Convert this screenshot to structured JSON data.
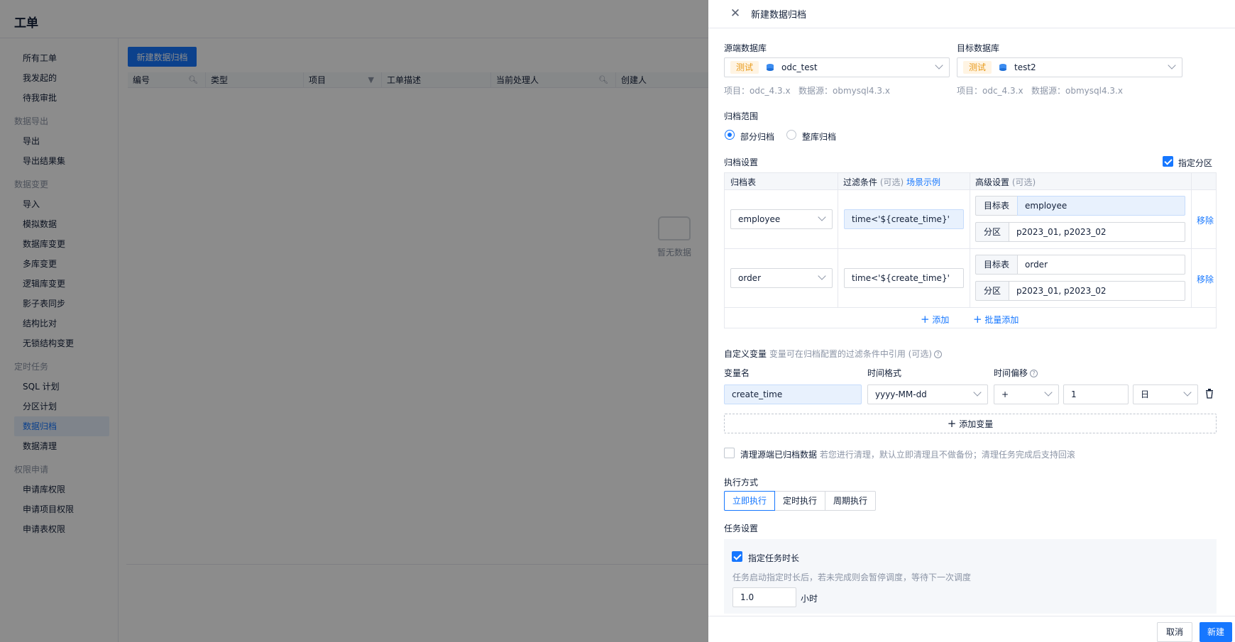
{
  "app": {
    "title": "工单",
    "sidebar": [
      {
        "type": "item",
        "label": "所有工单"
      },
      {
        "type": "item",
        "label": "我发起的"
      },
      {
        "type": "item",
        "label": "待我审批"
      },
      {
        "type": "group",
        "label": "数据导出"
      },
      {
        "type": "item",
        "label": "导出"
      },
      {
        "type": "item",
        "label": "导出结果集"
      },
      {
        "type": "group",
        "label": "数据变更"
      },
      {
        "type": "item",
        "label": "导入"
      },
      {
        "type": "item",
        "label": "模拟数据"
      },
      {
        "type": "item",
        "label": "数据库变更"
      },
      {
        "type": "item",
        "label": "多库变更"
      },
      {
        "type": "item",
        "label": "逻辑库变更"
      },
      {
        "type": "item",
        "label": "影子表同步"
      },
      {
        "type": "item",
        "label": "结构比对"
      },
      {
        "type": "item",
        "label": "无锁结构变更"
      },
      {
        "type": "group",
        "label": "定时任务"
      },
      {
        "type": "item",
        "label": "SQL 计划"
      },
      {
        "type": "item",
        "label": "分区计划"
      },
      {
        "type": "item",
        "label": "数据归档",
        "active": true
      },
      {
        "type": "item",
        "label": "数据清理"
      },
      {
        "type": "group",
        "label": "权限申请"
      },
      {
        "type": "item",
        "label": "申请库权限"
      },
      {
        "type": "item",
        "label": "申请项目权限"
      },
      {
        "type": "item",
        "label": "申请表权限"
      }
    ],
    "new_button": "新建数据归档",
    "columns": [
      "编号",
      "类型",
      "项目",
      "工单描述",
      "当前处理人",
      "创建人"
    ],
    "empty_text": "暂无数据"
  },
  "drawer": {
    "title": "新建数据归档",
    "source": {
      "label": "源端数据库",
      "env": "测试",
      "db": "odc_test",
      "project_meta": "项目：odc_4.3.x",
      "datasource_meta": "数据源：obmysql4.3.x"
    },
    "target": {
      "label": "目标数据库",
      "env": "测试",
      "db": "test2",
      "project_meta": "项目：odc_4.3.x",
      "datasource_meta": "数据源：obmysql4.3.x"
    },
    "scope": {
      "label": "归档范围",
      "options": [
        "部分归档",
        "整库归档"
      ],
      "selected": "部分归档"
    },
    "settings": {
      "label": "归档设置",
      "partition_check_label": "指定分区",
      "col_table": "归档表",
      "col_filter": "过滤条件",
      "col_filter_opt": "(可选)",
      "col_filter_link": "场景示例",
      "col_advanced": "高级设置",
      "col_advanced_opt": "(可选)",
      "target_table_prefix": "目标表",
      "partition_prefix": "分区",
      "remove_label": "移除",
      "rows": [
        {
          "table": "employee",
          "filter": "time<'${create_time}'",
          "target": "employee",
          "partitions": "p2023_01, p2023_02"
        },
        {
          "table": "order",
          "filter": "time<'${create_time}'",
          "target": "order",
          "partitions": "p2023_01, p2023_02"
        }
      ],
      "add_label": "添加",
      "batch_add_label": "批量添加"
    },
    "variables": {
      "label": "自定义变量",
      "hint": "变量可在归档配置的过滤条件中引用 (可选)",
      "col_name": "变量名",
      "col_format": "时间格式",
      "col_offset": "时间偏移",
      "name_value": "create_time",
      "format_value": "yyyy-MM-dd",
      "offset_sign": "+",
      "offset_value": "1",
      "offset_unit": "日",
      "add_label": "添加变量"
    },
    "cleanup": {
      "label": "清理源端已归档数据",
      "hint": "若您进行清理，默认立即清理且不做备份；清理任务完成后支持回滚"
    },
    "exec": {
      "label": "执行方式",
      "options": [
        "立即执行",
        "定时执行",
        "周期执行"
      ],
      "selected": "立即执行"
    },
    "task": {
      "label": "任务设置",
      "duration_label": "指定任务时长",
      "duration_hint": "任务启动指定时长后，若未完成则会暂停调度，等待下一次调度",
      "duration_value": "1.0",
      "duration_unit": "小时"
    },
    "footer": {
      "cancel": "取消",
      "submit": "新建"
    }
  },
  "colors": {
    "primary": "#1677ff",
    "env_tag_bg": "#fff4e3",
    "env_tag_text": "#e89a1a",
    "mask": "rgba(0,0,0,0.45)"
  }
}
